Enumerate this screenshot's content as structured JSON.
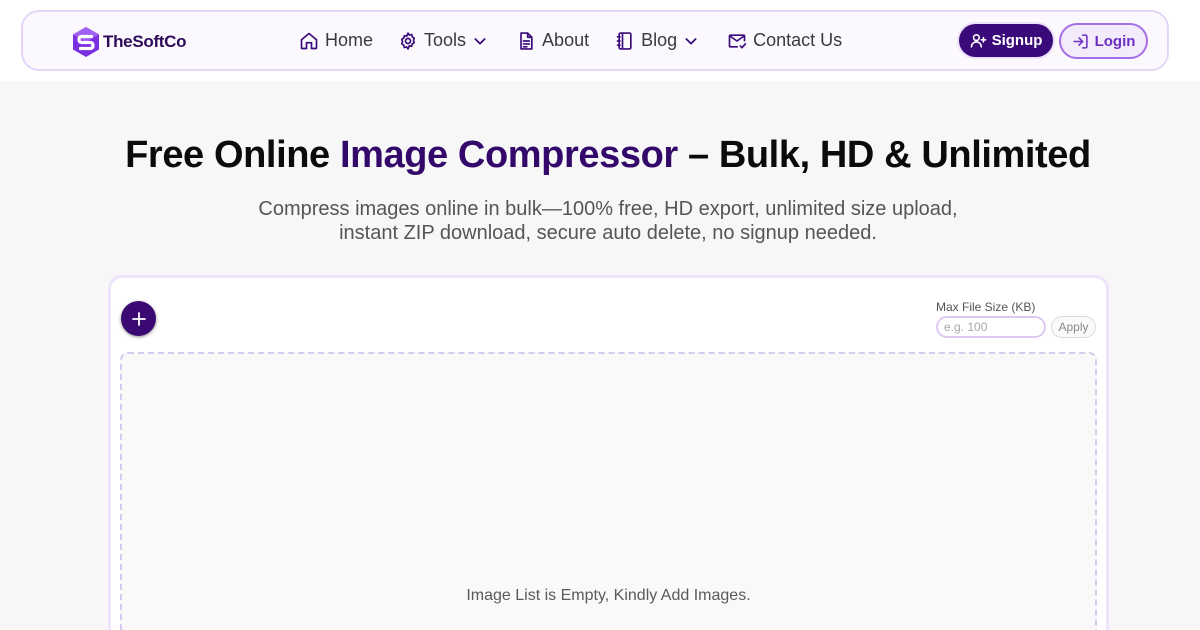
{
  "brand": {
    "name": "TheSoftCo",
    "logo_icon": "hexagon-s-logo"
  },
  "nav": {
    "items": [
      {
        "label": "Home",
        "icon": "home-icon"
      },
      {
        "label": "Tools",
        "icon": "gear-icon",
        "dropdown": true
      },
      {
        "label": "About",
        "icon": "document-icon"
      },
      {
        "label": "Blog",
        "icon": "notebook-icon",
        "dropdown": true
      },
      {
        "label": "Contact Us",
        "icon": "mail-icon"
      }
    ],
    "signup_label": "Signup",
    "login_label": "Login"
  },
  "hero": {
    "title_prefix": "Free Online ",
    "title_accent": "Image Compressor",
    "title_suffix": " – Bulk, HD & Unlimited",
    "subtitle_line1": "Compress images online in bulk—100% free, HD export, unlimited size upload,",
    "subtitle_line2": "instant ZIP download, secure auto delete, no signup needed."
  },
  "tool": {
    "add_button_icon": "plus-icon",
    "max_size_label": "Max File Size (KB)",
    "max_size_placeholder": "e.g. 100",
    "max_size_value": "",
    "apply_label": "Apply",
    "empty_message": "Image List is Empty, Kindly Add Images."
  },
  "colors": {
    "accent": "#33086a",
    "primary_button": "#3b0a7a",
    "login_text": "#6b2fc0",
    "border_tint": "#e4d6f7",
    "background": "#f7f7f7"
  }
}
